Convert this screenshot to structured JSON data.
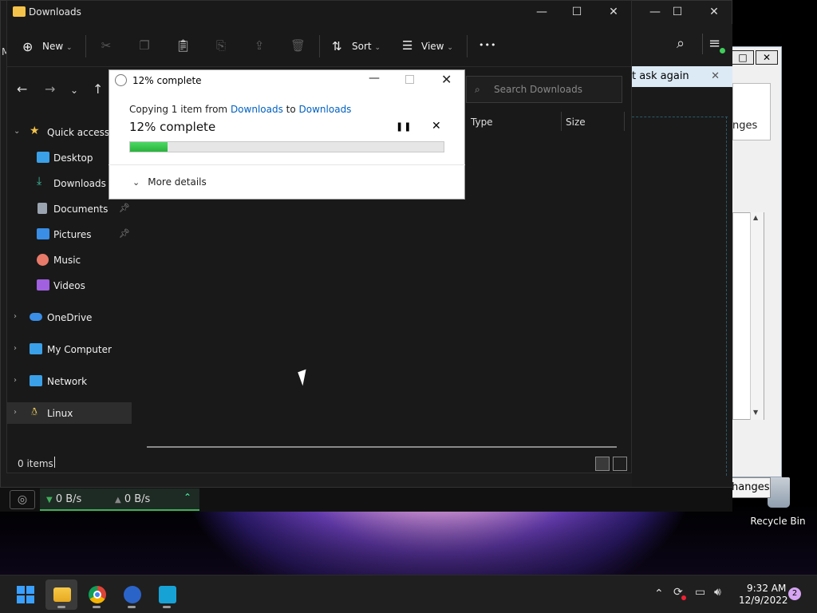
{
  "desktop": {
    "recycle_bin_label": "Recycle Bin"
  },
  "back_dialog": {
    "max_icon": "□",
    "close_icon": "✕",
    "notice_text": "t ask again",
    "changes_partial": "nges",
    "changes_button": "hanges"
  },
  "bg_window": {
    "left_edge_text": "M"
  },
  "speed_widget": {
    "down": "0 B/s",
    "up": "0 B/s",
    "down_arrow": "▼",
    "up_arrow": "▲",
    "caret": "⌃"
  },
  "explorer": {
    "title": "Downloads",
    "toolbar": {
      "new_label": "New",
      "sort_label": "Sort",
      "view_label": "View",
      "more_icon": "•••"
    },
    "search_placeholder": "Search Downloads",
    "columns": {
      "type": "Type",
      "size": "Size"
    },
    "sidebar": [
      {
        "label": "Quick access",
        "icon": "star-icon",
        "color": "#f3c24a",
        "pinned": false
      },
      {
        "label": "Desktop",
        "icon": "desktop-icon",
        "color": "#3aa0e8",
        "pinned": false
      },
      {
        "label": "Downloads",
        "icon": "download-icon",
        "color": "#3fc0a0",
        "pinned": false
      },
      {
        "label": "Documents",
        "icon": "documents-icon",
        "color": "#9aa4b0",
        "pinned": true
      },
      {
        "label": "Pictures",
        "icon": "pictures-icon",
        "color": "#3a8ee6",
        "pinned": true
      },
      {
        "label": "Music",
        "icon": "music-icon",
        "color": "#e87a6a",
        "pinned": false
      },
      {
        "label": "Videos",
        "icon": "videos-icon",
        "color": "#a060e0",
        "pinned": false
      },
      {
        "label": "OneDrive",
        "icon": "cloud-icon",
        "color": "#3a8ee6",
        "pinned": false
      },
      {
        "label": "My Computer",
        "icon": "computer-icon",
        "color": "#3aa0e8",
        "pinned": false
      },
      {
        "label": "Network",
        "icon": "network-icon",
        "color": "#3aa0e8",
        "pinned": false
      },
      {
        "label": "Linux",
        "icon": "linux-icon",
        "color": "#f0d060",
        "pinned": false
      }
    ],
    "status_items": "0 items"
  },
  "progress": {
    "title": "12% complete",
    "copy_prefix": "Copying 1 item from ",
    "source": "Downloads",
    "to_word": " to ",
    "dest": "Downloads",
    "status": "12% complete",
    "percent": 12,
    "more_details": "More details"
  },
  "taskbar": {
    "time": "9:32 AM",
    "date": "12/9/2022",
    "notifications": "2"
  }
}
